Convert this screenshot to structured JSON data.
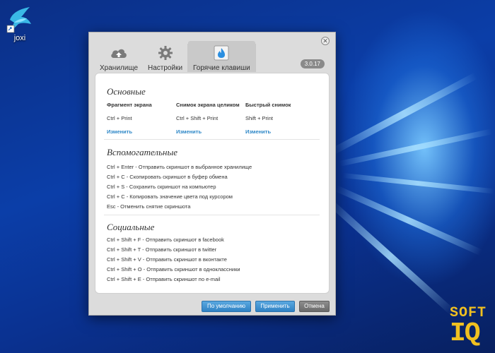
{
  "desktop": {
    "icon_label": "joxi",
    "logo_top": "SOFT",
    "logo_bottom": "IQ"
  },
  "window": {
    "close_icon": "close-icon",
    "version": "3.0.17",
    "tabs": [
      {
        "label": "Хранилище",
        "icon": "cloud-upload-icon",
        "active": false
      },
      {
        "label": "Настройки",
        "icon": "gear-icon",
        "active": false
      },
      {
        "label": "Горячие клавиши",
        "icon": "flame-icon",
        "active": true
      }
    ],
    "main": {
      "title": "Основные",
      "columns": [
        {
          "header": "Фрагмент экрана",
          "keys": "Ctrl + Print",
          "link": "Изменить"
        },
        {
          "header": "Снимок экрана целиком",
          "keys": "Ctrl + Shift + Print",
          "link": "Изменить"
        },
        {
          "header": "Быстрый снимок",
          "keys": "Shift + Print",
          "link": "Изменить"
        }
      ]
    },
    "aux": {
      "title": "Вспомогательные",
      "lines": [
        "Ctrl + Enter - Отправить скриншот в выбранное хранилище",
        "Ctrl + C - Скопировать скриншот в буфер обмена",
        "Ctrl + S - Сохранить скриншот на компьютер",
        "Ctrl + C - Копировать значение цвета под курсором",
        "Esc - Отменить снятие скриншота"
      ]
    },
    "social": {
      "title": "Социальные",
      "lines": [
        "Ctrl + Shift + F - Отправить скриншот в facebook",
        "Ctrl + Shift + T - Отправить скриншот в twitter",
        "Ctrl + Shift + V - Отправить скриншот в вконтакте",
        "Ctrl + Shift + O - Отправить скриншот в одноклассники",
        "Ctrl + Shift + E - Отправить скриншот по e-mail"
      ]
    },
    "buttons": {
      "default": "По умолчанию",
      "apply": "Применить",
      "cancel": "Отмена"
    },
    "colors": {
      "link": "#2d87c7",
      "accent_blue": "#2f82c4",
      "flame": "#2b8fe0"
    }
  }
}
